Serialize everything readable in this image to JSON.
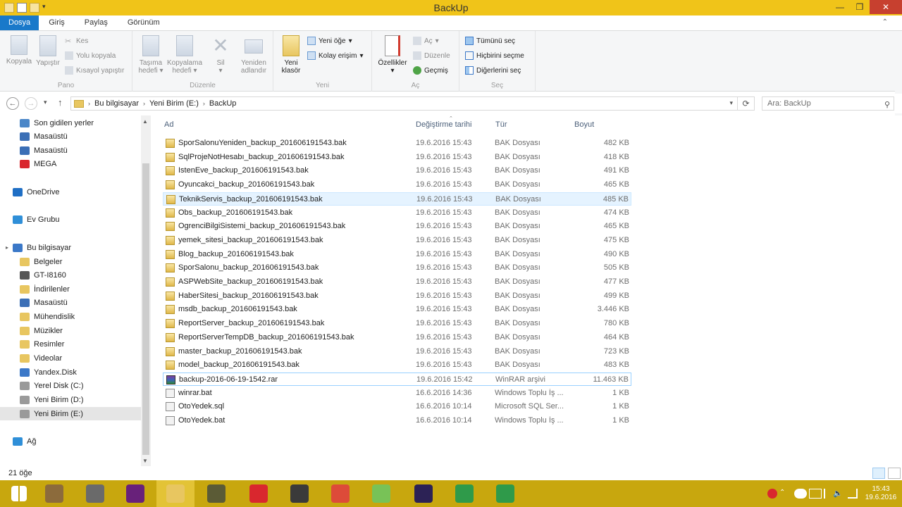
{
  "window": {
    "title": "BackUp",
    "controls": {
      "minimize": "—",
      "maximize": "❐",
      "close": "✕"
    }
  },
  "ribbon_tabs": [
    "Dosya",
    "Giriş",
    "Paylaş",
    "Görünüm"
  ],
  "ribbon": {
    "pano": {
      "label": "Pano",
      "kopyala": "Kopyala",
      "yapistir": "Yapıştır",
      "kes": "Kes",
      "yolu_kopyala": "Yolu kopyala",
      "kisayol_yapistir": "Kısayol yapıştır"
    },
    "duzenle": {
      "label": "Düzenle",
      "tasima_hedefi": [
        "Taşıma",
        "hedefi"
      ],
      "kopyalama_hedefi": [
        "Kopyalama",
        "hedefi"
      ],
      "sil": "Sil",
      "yeniden_adlandir": [
        "Yeniden",
        "adlandır"
      ]
    },
    "yeni": {
      "label": "Yeni",
      "yeni_klasor": [
        "Yeni",
        "klasör"
      ],
      "yeni_oge": "Yeni öğe",
      "kolay_erisim": "Kolay erişim"
    },
    "ac": {
      "label": "Aç",
      "ozellikler": "Özellikler",
      "ac_btn": "Aç",
      "duzenle_btn": "Düzenle",
      "gecmis": "Geçmiş"
    },
    "sec": {
      "label": "Seç",
      "tumunu_sec": "Tümünü seç",
      "hicbirini_secme": "Hiçbirini seçme",
      "digerlerini_sec": "Diğerlerini seç"
    }
  },
  "address": {
    "crumbs": [
      "Bu bilgisayar",
      "Yeni Birim (E:)",
      "BackUp"
    ],
    "search_placeholder": "Ara: BackUp"
  },
  "nav": [
    {
      "label": "Son gidilen yerler",
      "icon": "recent-places-icon",
      "color": "#4a86c8"
    },
    {
      "label": "Masaüstü",
      "icon": "desktop-icon",
      "color": "#3b6fb6"
    },
    {
      "label": "Masaüstü",
      "icon": "desktop-icon",
      "color": "#3b6fb6"
    },
    {
      "label": "MEGA",
      "icon": "mega-icon",
      "color": "#d9272e"
    },
    {
      "label": "OneDrive",
      "icon": "onedrive-icon",
      "color": "#1f6fc5"
    },
    {
      "label": "Ev Grubu",
      "icon": "homegroup-icon",
      "color": "#2f8fd8"
    },
    {
      "label": "Bu bilgisayar",
      "icon": "computer-icon",
      "color": "#3b78c8"
    },
    {
      "label": "Belgeler",
      "icon": "documents-icon",
      "color": "#e8c660"
    },
    {
      "label": "GT-I8160",
      "icon": "phone-icon",
      "color": "#555555"
    },
    {
      "label": "İndirilenler",
      "icon": "downloads-icon",
      "color": "#e8c660"
    },
    {
      "label": "Masaüstü",
      "icon": "desktop-icon",
      "color": "#3b6fb6"
    },
    {
      "label": "Mühendislik",
      "icon": "folder-icon",
      "color": "#e8c660"
    },
    {
      "label": "Müzikler",
      "icon": "music-icon",
      "color": "#e8c660"
    },
    {
      "label": "Resimler",
      "icon": "pictures-icon",
      "color": "#e8c660"
    },
    {
      "label": "Videolar",
      "icon": "videos-icon",
      "color": "#e8c660"
    },
    {
      "label": "Yandex.Disk",
      "icon": "yandex-disk-icon",
      "color": "#3b78c8"
    },
    {
      "label": "Yerel Disk (C:)",
      "icon": "drive-icon",
      "color": "#9a9a9a"
    },
    {
      "label": "Yeni Birim (D:)",
      "icon": "drive-icon",
      "color": "#9a9a9a"
    },
    {
      "label": "Yeni Birim (E:)",
      "icon": "drive-icon",
      "color": "#9a9a9a"
    },
    {
      "label": "Ağ",
      "icon": "network-icon",
      "color": "#2f8fd8"
    }
  ],
  "columns": {
    "name": "Ad",
    "date": "Değiştirme tarihi",
    "type": "Tür",
    "size": "Boyut"
  },
  "files": [
    {
      "name": "SporSalonuYeniden_backup_201606191543.bak",
      "date": "19.6.2016 15:43",
      "type": "BAK Dosyası",
      "size": "482 KB",
      "icon": "bak-file-icon"
    },
    {
      "name": "SqlProjeNotHesabı_backup_201606191543.bak",
      "date": "19.6.2016 15:43",
      "type": "BAK Dosyası",
      "size": "418 KB",
      "icon": "bak-file-icon"
    },
    {
      "name": "IstenEve_backup_201606191543.bak",
      "date": "19.6.2016 15:43",
      "type": "BAK Dosyası",
      "size": "491 KB",
      "icon": "bak-file-icon"
    },
    {
      "name": "Oyuncakci_backup_201606191543.bak",
      "date": "19.6.2016 15:43",
      "type": "BAK Dosyası",
      "size": "465 KB",
      "icon": "bak-file-icon"
    },
    {
      "name": "TeknikServis_backup_201606191543.bak",
      "date": "19.6.2016 15:43",
      "type": "BAK Dosyası",
      "size": "485 KB",
      "icon": "bak-file-icon"
    },
    {
      "name": "Obs_backup_201606191543.bak",
      "date": "19.6.2016 15:43",
      "type": "BAK Dosyası",
      "size": "474 KB",
      "icon": "bak-file-icon"
    },
    {
      "name": "OgrenciBilgiSistemi_backup_201606191543.bak",
      "date": "19.6.2016 15:43",
      "type": "BAK Dosyası",
      "size": "465 KB",
      "icon": "bak-file-icon"
    },
    {
      "name": "yemek_sitesi_backup_201606191543.bak",
      "date": "19.6.2016 15:43",
      "type": "BAK Dosyası",
      "size": "475 KB",
      "icon": "bak-file-icon"
    },
    {
      "name": "Blog_backup_201606191543.bak",
      "date": "19.6.2016 15:43",
      "type": "BAK Dosyası",
      "size": "490 KB",
      "icon": "bak-file-icon"
    },
    {
      "name": "SporSalonu_backup_201606191543.bak",
      "date": "19.6.2016 15:43",
      "type": "BAK Dosyası",
      "size": "505 KB",
      "icon": "bak-file-icon"
    },
    {
      "name": "ASPWebSite_backup_201606191543.bak",
      "date": "19.6.2016 15:43",
      "type": "BAK Dosyası",
      "size": "477 KB",
      "icon": "bak-file-icon"
    },
    {
      "name": "HaberSitesi_backup_201606191543.bak",
      "date": "19.6.2016 15:43",
      "type": "BAK Dosyası",
      "size": "499 KB",
      "icon": "bak-file-icon"
    },
    {
      "name": "msdb_backup_201606191543.bak",
      "date": "19.6.2016 15:43",
      "type": "BAK Dosyası",
      "size": "3.446 KB",
      "icon": "bak-file-icon"
    },
    {
      "name": "ReportServer_backup_201606191543.bak",
      "date": "19.6.2016 15:43",
      "type": "BAK Dosyası",
      "size": "780 KB",
      "icon": "bak-file-icon"
    },
    {
      "name": "ReportServerTempDB_backup_201606191543.bak",
      "date": "19.6.2016 15:43",
      "type": "BAK Dosyası",
      "size": "464 KB",
      "icon": "bak-file-icon"
    },
    {
      "name": "master_backup_201606191543.bak",
      "date": "19.6.2016 15:43",
      "type": "BAK Dosyası",
      "size": "723 KB",
      "icon": "bak-file-icon"
    },
    {
      "name": "model_backup_201606191543.bak",
      "date": "19.6.2016 15:43",
      "type": "BAK Dosyası",
      "size": "483 KB",
      "icon": "bak-file-icon"
    },
    {
      "name": "backup-2016-06-19-1542.rar",
      "date": "19.6.2016 15:42",
      "type": "WinRAR arşivi",
      "size": "11.463 KB",
      "icon": "winrar-archive-icon"
    },
    {
      "name": "winrar.bat",
      "date": "16.6.2016 14:36",
      "type": "Windows Toplu İş ...",
      "size": "1 KB",
      "icon": "batch-file-icon"
    },
    {
      "name": "OtoYedek.sql",
      "date": "16.6.2016 10:14",
      "type": "Microsoft SQL Ser...",
      "size": "1 KB",
      "icon": "sql-file-icon"
    },
    {
      "name": "OtoYedek.bat",
      "date": "16.6.2016 10:14",
      "type": "Windows Toplu İş ...",
      "size": "1 KB",
      "icon": "batch-file-icon"
    }
  ],
  "status": {
    "count": "21 öğe"
  },
  "taskbar": {
    "apps": [
      {
        "name": "start-button",
        "color": "#c8a70e"
      },
      {
        "name": "paint-icon",
        "color": "#8c6b3c"
      },
      {
        "name": "tools-icon",
        "color": "#6a6a6a"
      },
      {
        "name": "visual-studio-icon",
        "color": "#68217a"
      },
      {
        "name": "file-explorer-icon",
        "color": "#e8c660"
      },
      {
        "name": "gimp-icon",
        "color": "#5b5b36"
      },
      {
        "name": "recorder-icon",
        "color": "#d9272e"
      },
      {
        "name": "pen-tool-icon",
        "color": "#3a3a3a"
      },
      {
        "name": "chrome-icon",
        "color": "#dd4b39"
      },
      {
        "name": "android-studio-icon",
        "color": "#78c257"
      },
      {
        "name": "eclipse-icon",
        "color": "#2c2255"
      },
      {
        "name": "camtasia-icon",
        "color": "#2f9a4a"
      },
      {
        "name": "camtasia-recorder-icon",
        "color": "#2f9a4a"
      }
    ],
    "time": "15:43",
    "date": "19.6.2016"
  }
}
